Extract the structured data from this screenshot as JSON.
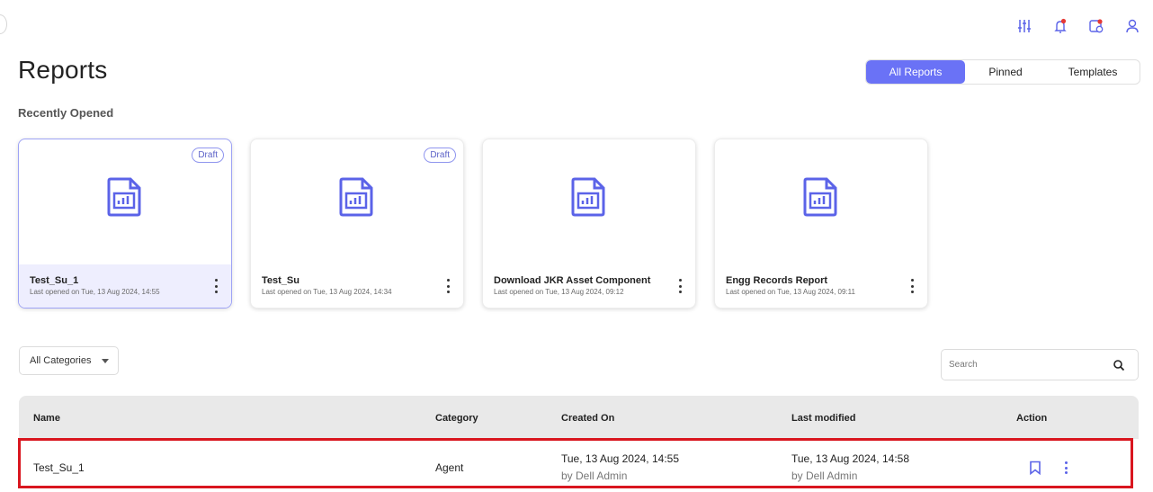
{
  "header": {
    "title": "Reports",
    "icons": [
      "filter-sliders-icon",
      "bell-icon",
      "calendar-icon",
      "user-icon"
    ]
  },
  "view_tabs": {
    "items": [
      {
        "label": "All Reports",
        "active": true
      },
      {
        "label": "Pinned",
        "active": false
      },
      {
        "label": "Templates",
        "active": false
      }
    ]
  },
  "recent": {
    "label": "Recently Opened",
    "cards": [
      {
        "title": "Test_Su_1",
        "subtitle": "Last opened on Tue, 13 Aug 2024, 14:55",
        "badge": "Draft",
        "selected": true
      },
      {
        "title": "Test_Su",
        "subtitle": "Last opened on Tue, 13 Aug 2024, 14:34",
        "badge": "Draft",
        "selected": false
      },
      {
        "title": "Download JKR Asset Component",
        "subtitle": "Last opened on Tue, 13 Aug 2024, 09:12",
        "badge": "",
        "selected": false
      },
      {
        "title": "Engg Records Report",
        "subtitle": "Last opened on Tue, 13 Aug 2024, 09:11",
        "badge": "",
        "selected": false
      }
    ]
  },
  "filters": {
    "category_value": "All Categories",
    "search_placeholder": "Search"
  },
  "table": {
    "columns": [
      "Name",
      "Category",
      "Created On",
      "Last modified",
      "Action"
    ],
    "rows": [
      {
        "name": "Test_Su_1",
        "category": "Agent",
        "created_date": "Tue, 13 Aug 2024, 14:55",
        "created_by": "by Dell Admin",
        "modified_date": "Tue, 13 Aug 2024, 14:58",
        "modified_by": "by Dell Admin",
        "highlighted": true
      }
    ]
  },
  "colors": {
    "accent": "#6a72f6",
    "highlight_border": "#d9161f",
    "notification_dot": "#e53935"
  }
}
